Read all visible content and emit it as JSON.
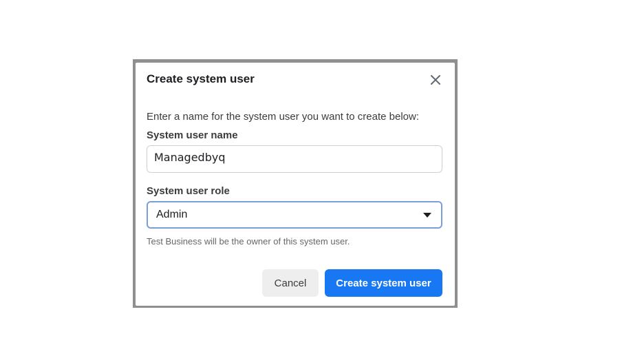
{
  "dialog": {
    "title": "Create system user",
    "intro": "Enter a name for the system user you want to create below:",
    "name_label": "System user name",
    "name_value": "Managedbyq",
    "role_label": "System user role",
    "role_value": "Admin",
    "help_text": "Test Business will be the owner of this system user.",
    "cancel_label": "Cancel",
    "create_label": "Create system user",
    "close_icon": "close-icon",
    "dropdown_icon": "caret-down-icon"
  },
  "colors": {
    "primary": "#1877f2",
    "overlay": "#8f8f8f",
    "focus_border": "#7a9ed6"
  }
}
